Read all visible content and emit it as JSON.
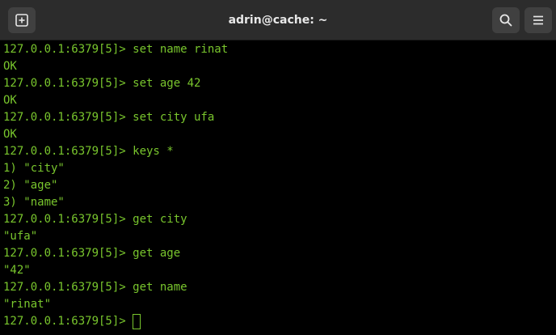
{
  "window": {
    "title": "adrin@cache: ~"
  },
  "toolbar": {
    "new_tab_icon": "new-tab-icon",
    "search_icon": "search-icon",
    "menu_icon": "hamburger-menu-icon"
  },
  "terminal": {
    "lines": [
      "127.0.0.1:6379[5]> set name rinat",
      "OK",
      "127.0.0.1:6379[5]> set age 42",
      "OK",
      "127.0.0.1:6379[5]> set city ufa",
      "OK",
      "127.0.0.1:6379[5]> keys *",
      "1) \"city\"",
      "2) \"age\"",
      "3) \"name\"",
      "127.0.0.1:6379[5]> get city",
      "\"ufa\"",
      "127.0.0.1:6379[5]> get age",
      "\"42\"",
      "127.0.0.1:6379[5]> get name",
      "\"rinat\""
    ],
    "prompt": "127.0.0.1:6379[5]> "
  },
  "colors": {
    "text": "#79c62d",
    "background": "#000000",
    "titlebar": "#2c2c2c"
  }
}
